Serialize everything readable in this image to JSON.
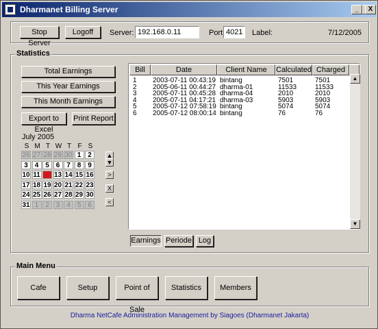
{
  "window": {
    "title": "Dharmanet Billing Server",
    "controls": [
      "_",
      "□",
      "X"
    ]
  },
  "toolbar": {
    "stop_server": "Stop Server",
    "logoff": "Logoff",
    "server_label": "Server:",
    "server_value": "192.168.0.11",
    "port_label": "Port:",
    "port_value": "4021",
    "label_label": "Label:",
    "date": "7/12/2005"
  },
  "statistics": {
    "title": "Statistics",
    "total_earnings": "Total Earnings",
    "this_year": "This Year Earnings",
    "this_month": "This Month Earnings",
    "export_excel": "Export to Excel",
    "print_report": "Print Report"
  },
  "calendar": {
    "month": "July 2005",
    "weekdays": [
      "S",
      "M",
      "T",
      "W",
      "T",
      "F",
      "S"
    ],
    "weeks": [
      [
        {
          "d": "26",
          "o": true
        },
        {
          "d": "27",
          "o": true
        },
        {
          "d": "28",
          "o": true
        },
        {
          "d": "29",
          "o": true
        },
        {
          "d": "30",
          "o": true
        },
        {
          "d": "1",
          "o": false
        },
        {
          "d": "2",
          "o": false
        }
      ],
      [
        {
          "d": "3",
          "o": false
        },
        {
          "d": "4",
          "o": false
        },
        {
          "d": "5",
          "o": false
        },
        {
          "d": "6",
          "o": false
        },
        {
          "d": "7",
          "o": false
        },
        {
          "d": "8",
          "o": false
        },
        {
          "d": "9",
          "o": false
        }
      ],
      [
        {
          "d": "10",
          "o": false
        },
        {
          "d": "11",
          "o": false
        },
        {
          "d": "12",
          "o": false,
          "today": true
        },
        {
          "d": "13",
          "o": false
        },
        {
          "d": "14",
          "o": false
        },
        {
          "d": "15",
          "o": false
        },
        {
          "d": "16",
          "o": false
        }
      ],
      [
        {
          "d": "17",
          "o": false
        },
        {
          "d": "18",
          "o": false
        },
        {
          "d": "19",
          "o": false
        },
        {
          "d": "20",
          "o": false
        },
        {
          "d": "21",
          "o": false
        },
        {
          "d": "22",
          "o": false
        },
        {
          "d": "23",
          "o": false
        }
      ],
      [
        {
          "d": "24",
          "o": false
        },
        {
          "d": "25",
          "o": false
        },
        {
          "d": "26",
          "o": false
        },
        {
          "d": "27",
          "o": false
        },
        {
          "d": "28",
          "o": false
        },
        {
          "d": "29",
          "o": false
        },
        {
          "d": "30",
          "o": false
        }
      ],
      [
        {
          "d": "31",
          "o": false
        },
        {
          "d": "1",
          "o": true
        },
        {
          "d": "2",
          "o": true
        },
        {
          "d": "3",
          "o": true
        },
        {
          "d": "4",
          "o": true
        },
        {
          "d": "5",
          "o": true
        },
        {
          "d": "6",
          "o": true
        }
      ]
    ],
    "today_color": "#d0181b",
    "side_buttons": [
      ">",
      "X",
      "<"
    ]
  },
  "table": {
    "columns": [
      "Bill",
      "Date",
      "Client Name",
      "Calculated",
      "Charged"
    ],
    "rows": [
      [
        "1",
        "2003-07-11 00:43:19",
        "bintang",
        "7501",
        "7501"
      ],
      [
        "2",
        "2005-06-11 00:44:27",
        "dharma-01",
        "11533",
        "11533"
      ],
      [
        "3",
        "2005-07-11 00:45:28",
        "dharma-04",
        "2010",
        "2010"
      ],
      [
        "4",
        "2005-07-11 04:17:21",
        "dharma-03",
        "5903",
        "5903"
      ],
      [
        "5",
        "2005-07-12 07:58:19",
        "bintang",
        "5074",
        "5074"
      ],
      [
        "6",
        "2005-07-12 08:00:14",
        "bintang",
        "76",
        "76"
      ]
    ]
  },
  "tabs": [
    "Earnings",
    "Periode",
    "Log"
  ],
  "main_menu": {
    "title": "Main Menu",
    "items": [
      "Cafe",
      "Setup",
      "Point of Sale",
      "Statistics",
      "Members"
    ]
  },
  "footer": "Dharma NetCafe Administration Management by Siagoes (Dharmanet Jakarta)"
}
